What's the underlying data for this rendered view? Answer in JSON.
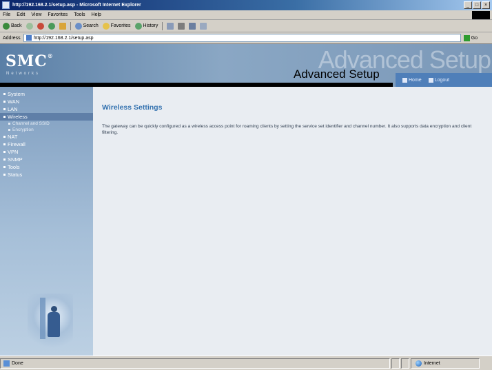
{
  "window": {
    "title": "http://192.168.2.1/setup.asp - Microsoft Internet Explorer",
    "buttons": [
      "_",
      "□",
      "×"
    ]
  },
  "menu": [
    "File",
    "Edit",
    "View",
    "Favorites",
    "Tools",
    "Help"
  ],
  "toolbar": {
    "back": "Back",
    "search": "Search",
    "favorites": "Favorites",
    "history": "History"
  },
  "address": {
    "label": "Address",
    "url": "http://192.168.2.1/setup.asp",
    "go": "Go"
  },
  "banner": {
    "logo": "SMC",
    "logo_reg": "®",
    "logo_sub": "Networks",
    "ghost_text": "Advanced Setup",
    "title": "Advanced Setup",
    "home": "Home",
    "logout": "Logout"
  },
  "sidebar": {
    "items": [
      {
        "label": "System"
      },
      {
        "label": "WAN"
      },
      {
        "label": "LAN"
      },
      {
        "label": "Wireless"
      },
      {
        "label": "NAT"
      },
      {
        "label": "Firewall"
      },
      {
        "label": "VPN"
      },
      {
        "label": "SNMP"
      },
      {
        "label": "Tools"
      },
      {
        "label": "Status"
      }
    ],
    "subitems": [
      {
        "label": "Channel and SSID"
      },
      {
        "label": "Encryption"
      }
    ]
  },
  "content": {
    "heading": "Wireless Settings",
    "description": "The gateway can be quickly configured as a wireless access point for roaming clients by setting the service set identifier and channel number. It also supports data encryption and client filtering."
  },
  "status": {
    "text": "Done",
    "zone": "Internet"
  },
  "colors": {
    "heading": "#3573b0",
    "sidebar": "#7f9ec0",
    "page_bg": "#e9edf2"
  }
}
